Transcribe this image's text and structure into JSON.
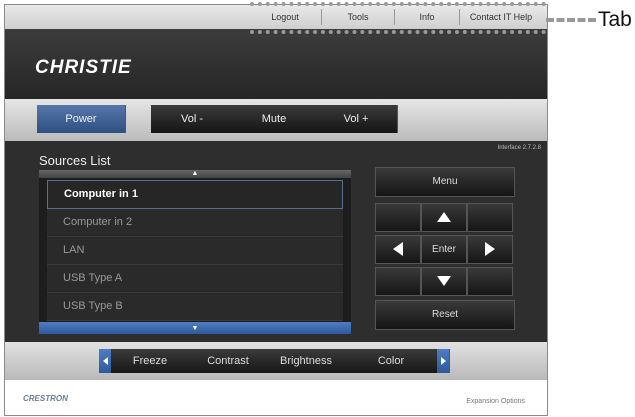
{
  "tabs": [
    "Logout",
    "Tools",
    "Info",
    "Contact IT Help"
  ],
  "callout_label": "Tab",
  "brand": "CHRISTIE",
  "power_bar": {
    "power": "Power",
    "vol_down": "Vol -",
    "mute": "Mute",
    "vol_up": "Vol +"
  },
  "version": "Interface 2.7.2.8",
  "sources": {
    "title": "Sources List",
    "items": [
      "Computer in 1",
      "Computer in 2",
      "LAN",
      "USB Type A",
      "USB Type B"
    ],
    "selected": "Computer in 1"
  },
  "keypad": {
    "menu": "Menu",
    "enter": "Enter",
    "reset": "Reset"
  },
  "bottom_bar": [
    "Freeze",
    "Contrast",
    "Brightness",
    "Color"
  ],
  "footer": {
    "crestron": "CRESTRON",
    "expansion": "Expansion Options"
  },
  "colors": {
    "accent_blue": "#2f4f82",
    "panel_dark": "#2e2e2e"
  }
}
